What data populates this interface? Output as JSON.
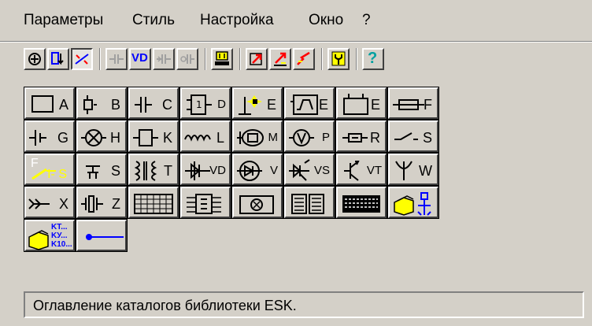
{
  "menu": {
    "items": [
      {
        "label": "Параметры"
      },
      {
        "label": "Стиль"
      },
      {
        "label": "Настройка"
      },
      {
        "label": "Окно"
      },
      {
        "label": "?"
      }
    ]
  },
  "toolbar": {
    "vd_label": "VD",
    "help_label": "?"
  },
  "palette": {
    "row1": [
      "A",
      "B",
      "C",
      "D",
      "E",
      "E",
      "E",
      "F"
    ],
    "row2": [
      "G",
      "H",
      "K",
      "L",
      "M",
      "P",
      "R",
      "S"
    ],
    "row3": [
      "I- S",
      "S",
      "T",
      "VD",
      "V",
      "VS",
      "VT",
      "W"
    ],
    "row4": [
      "X",
      "Z"
    ],
    "row3_prefix": "F",
    "row5_mini": [
      "KT...",
      "KУ...",
      "K10..."
    ]
  },
  "status": {
    "text": "Оглавление каталогов библиотеки ESK."
  },
  "colors": {
    "face": "#d4d0c8",
    "accent_blue": "#0000ff",
    "accent_red": "#ff0000",
    "accent_yellow": "#ffff00",
    "accent_teal": "#00a0a0"
  }
}
